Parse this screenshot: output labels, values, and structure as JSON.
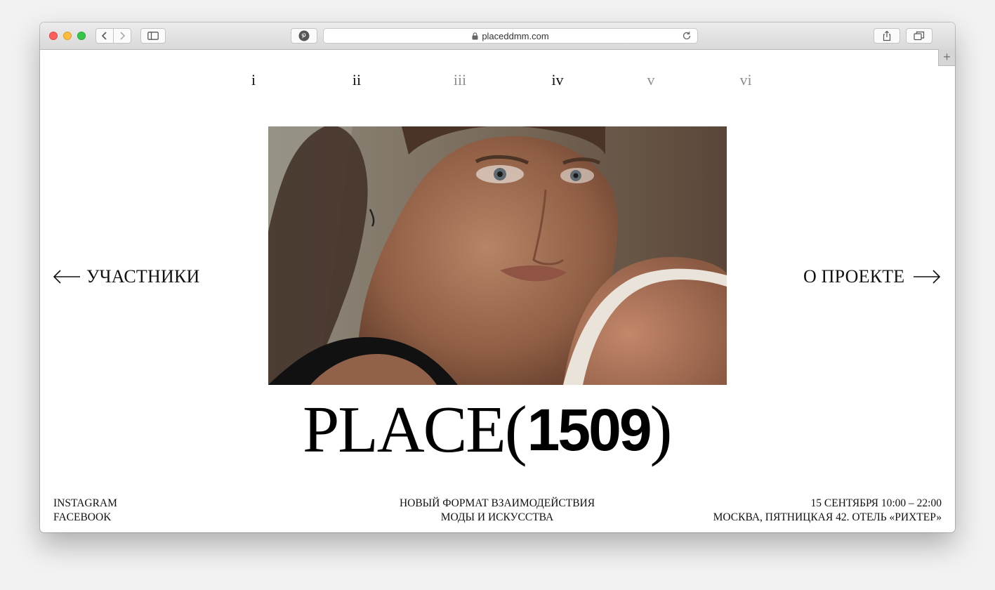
{
  "browser": {
    "url": "placeddmm.com",
    "new_tab_label": "+"
  },
  "nav": {
    "items": [
      {
        "label": "i",
        "dim": false
      },
      {
        "label": "ii",
        "dim": false
      },
      {
        "label": "iii",
        "dim": true
      },
      {
        "label": "iv",
        "dim": false
      },
      {
        "label": "v",
        "dim": true
      },
      {
        "label": "vi",
        "dim": true
      }
    ]
  },
  "left_link": "УЧАСТНИКИ",
  "right_link": "О ПРОЕКТЕ",
  "brand": {
    "word": "PLACE",
    "open_paren": "(",
    "number": "1509",
    "close_paren": ")"
  },
  "footer": {
    "social": [
      "INSTAGRAM",
      "FACEBOOK"
    ],
    "tagline": [
      "НОВЫЙ ФОРМАТ ВЗАИМОДЕЙСТВИЯ",
      "МОДЫ И ИСКУССТВА"
    ],
    "event": [
      "15 СЕНТЯБРЯ 10:00 – 22:00",
      "МОСКВА, ПЯТНИЦКАЯ 42. ОТЕЛЬ «РИХТЕР»"
    ]
  }
}
